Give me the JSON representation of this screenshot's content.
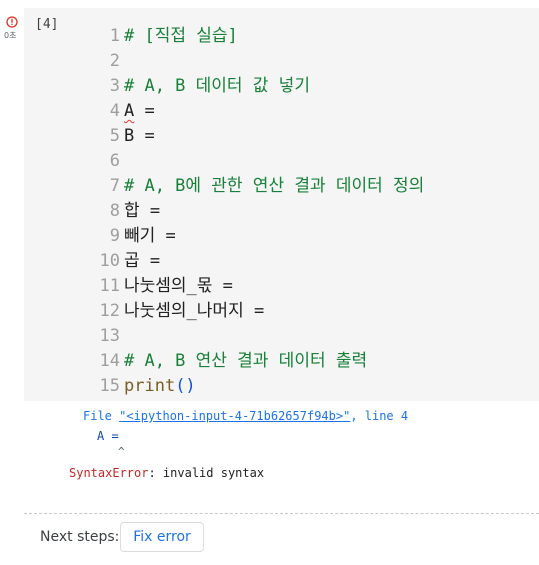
{
  "cell": {
    "exec_count": "[4]",
    "run_time": "0초",
    "status": "error"
  },
  "code_lines": [
    {
      "n": "1",
      "text": "# [직접 실습]",
      "kind": "comment"
    },
    {
      "n": "2",
      "text": "",
      "kind": "code"
    },
    {
      "n": "3",
      "text": "# A, B 데이터 값 넣기",
      "kind": "comment"
    },
    {
      "n": "4",
      "text": "A =",
      "kind": "code"
    },
    {
      "n": "5",
      "text": "B =",
      "kind": "code"
    },
    {
      "n": "6",
      "text": "",
      "kind": "code"
    },
    {
      "n": "7",
      "text": "# A, B에 관한 연산 결과 데이터 정의",
      "kind": "comment"
    },
    {
      "n": "8",
      "text": "합 =",
      "kind": "code"
    },
    {
      "n": "9",
      "text": "빼기 =",
      "kind": "code"
    },
    {
      "n": "10",
      "text": "곱 =",
      "kind": "code"
    },
    {
      "n": "11",
      "text": "나눗셈의_몫 =",
      "kind": "code"
    },
    {
      "n": "12",
      "text": "나눗셈의_나머지 =",
      "kind": "code"
    },
    {
      "n": "13",
      "text": "",
      "kind": "code"
    },
    {
      "n": "14",
      "text": "# A, B 연산 결과 데이터 출력",
      "kind": "comment"
    },
    {
      "n": "15",
      "text": "print()",
      "kind": "print"
    }
  ],
  "traceback": {
    "file_prefix": "File ",
    "file_link": "\"<ipython-input-4-71b62657f94b>\"",
    "line_suffix": ", line 4",
    "code": "A =",
    "caret": "^",
    "error_type": "SyntaxError",
    "error_msg": ": invalid syntax"
  },
  "footer": {
    "next_steps_label": "Next steps:",
    "fix_button": "Fix error"
  },
  "colors": {
    "comment": "#188038",
    "error_icon": "#d93025",
    "link": "#1a73e8"
  },
  "icons": [
    "error-circle-icon"
  ]
}
